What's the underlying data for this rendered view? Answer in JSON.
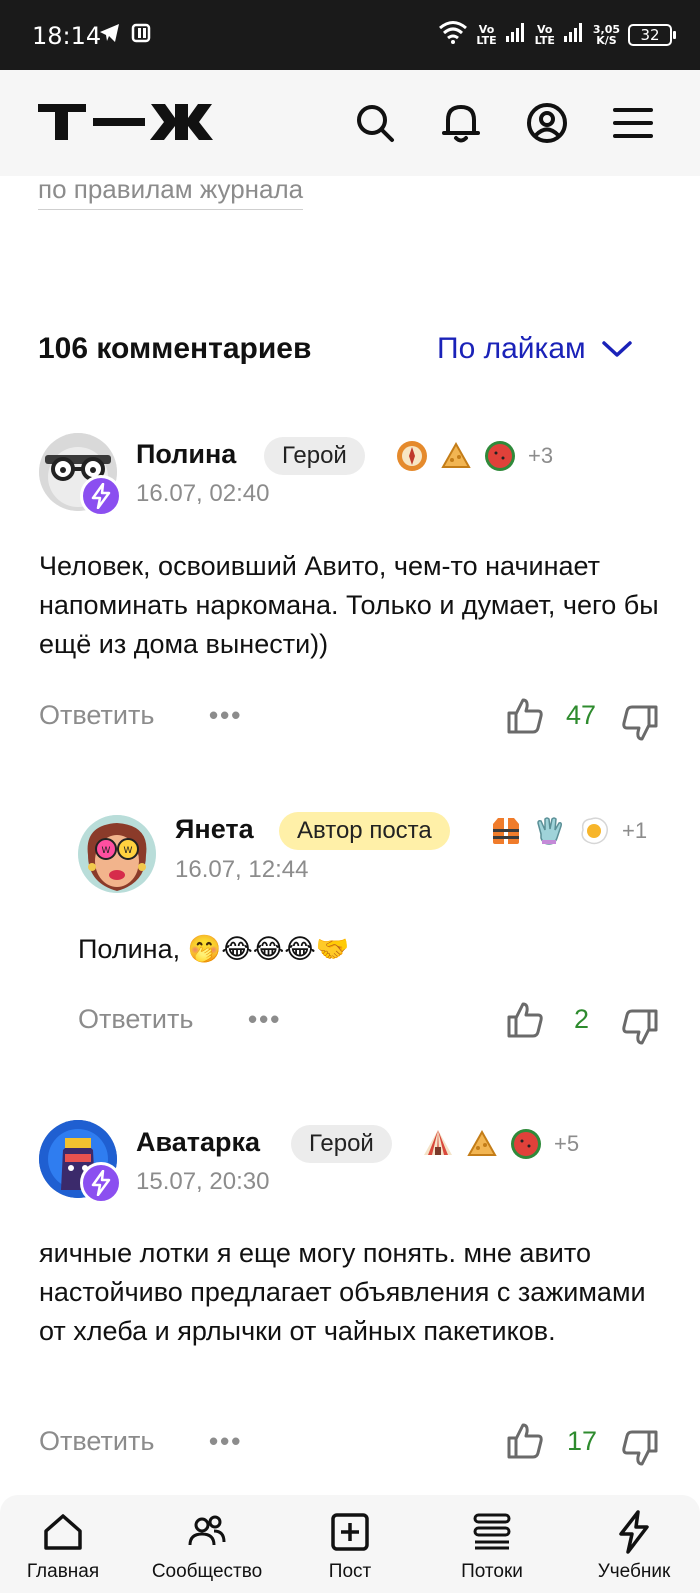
{
  "status_bar": {
    "time": "18:14",
    "net_speed_top": "3,05",
    "net_speed_bottom": "K/S",
    "battery": "32",
    "sim1_top": "Vo",
    "sim1_bottom": "LTE",
    "sim2_top": "Vo",
    "sim2_bottom": "LTE"
  },
  "header": {
    "logo": "Т—Ж",
    "icons": [
      "search-icon",
      "bell-icon",
      "profile-icon",
      "menu-icon"
    ]
  },
  "content": {
    "rules_link": "по правилам журнала",
    "comments_count_title": "106 комментариев",
    "sort_label": "По лайкам"
  },
  "comments": [
    {
      "author": "Полина",
      "badge": "Герой",
      "stickers_more": "+3",
      "date": "16.07, 02:40",
      "text": "Человек, освоивший Авито, чем-то начинает напоминать наркомана. Только и думает, чего бы ещё из дома вынести))",
      "reply_label": "Ответить",
      "more_label": "•••",
      "likes": "47"
    },
    {
      "author": "Янета",
      "badge": "Автор поста",
      "stickers_more": "+1",
      "date": "16.07, 12:44",
      "text": "Полина, 🤭😂😂😂🤝",
      "reply_label": "Ответить",
      "more_label": "•••",
      "likes": "2"
    },
    {
      "author": "Аватарка",
      "badge": "Герой",
      "stickers_more": "+5",
      "date": "15.07, 20:30",
      "text": "яичные лотки я еще могу понять. мне авито настойчиво предлагает объявления с зажимами от хлеба и ярлычки от чайных пакетиков.",
      "reply_label": "Ответить",
      "more_label": "•••",
      "likes": "17"
    }
  ],
  "bottom_nav": [
    {
      "label": "Главная",
      "icon": "home-icon"
    },
    {
      "label": "Сообщество",
      "icon": "community-icon"
    },
    {
      "label": "Пост",
      "icon": "add-post-icon"
    },
    {
      "label": "Потоки",
      "icon": "streams-icon"
    },
    {
      "label": "Учебник",
      "icon": "lightning-icon"
    }
  ],
  "colors": {
    "accent_blue": "#1a22b8",
    "likes_green": "#2e8b2e",
    "muted_gray": "#8c8c8c",
    "hero_badge_bg": "#ececec",
    "author_badge_bg": "#fff0a8",
    "avatar_badge_purple": "#8b4ff0"
  }
}
